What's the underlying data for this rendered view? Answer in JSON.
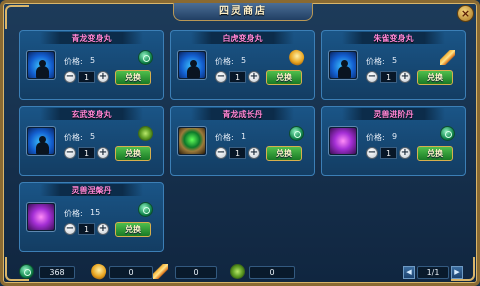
{
  "window": {
    "title": "四灵商店",
    "close_label": "×"
  },
  "labels": {
    "price": "价格:",
    "exchange": "兑换",
    "minus": "−",
    "plus": "+"
  },
  "items": [
    {
      "name": "青龙变身丸",
      "price": "5",
      "qty": "1",
      "currency_icon": "jade-coin-icon"
    },
    {
      "name": "白虎变身丸",
      "price": "5",
      "qty": "1",
      "currency_icon": "gold-gem-icon"
    },
    {
      "name": "朱雀变身丸",
      "price": "5",
      "qty": "1",
      "currency_icon": "feather-icon"
    },
    {
      "name": "玄武变身丸",
      "price": "5",
      "qty": "1",
      "currency_icon": "turtle-shell-icon"
    },
    {
      "name": "青龙成长丹",
      "price": "1",
      "qty": "1",
      "currency_icon": "jade-coin-icon"
    },
    {
      "name": "灵兽进阶丹",
      "price": "9",
      "qty": "1",
      "currency_icon": "jade-coin-icon"
    },
    {
      "name": "灵兽涅槃丹",
      "price": "15",
      "qty": "1",
      "currency_icon": "jade-coin-icon"
    }
  ],
  "footer": {
    "jade_amount": "368",
    "gold_amount": "0",
    "feather_amount": "0",
    "turtle_amount": "0",
    "page": "1/1"
  },
  "colors": {
    "accent_gold": "#d9b56a",
    "item_name": "#ff86d6",
    "exchange_green": "#2e9a36"
  }
}
